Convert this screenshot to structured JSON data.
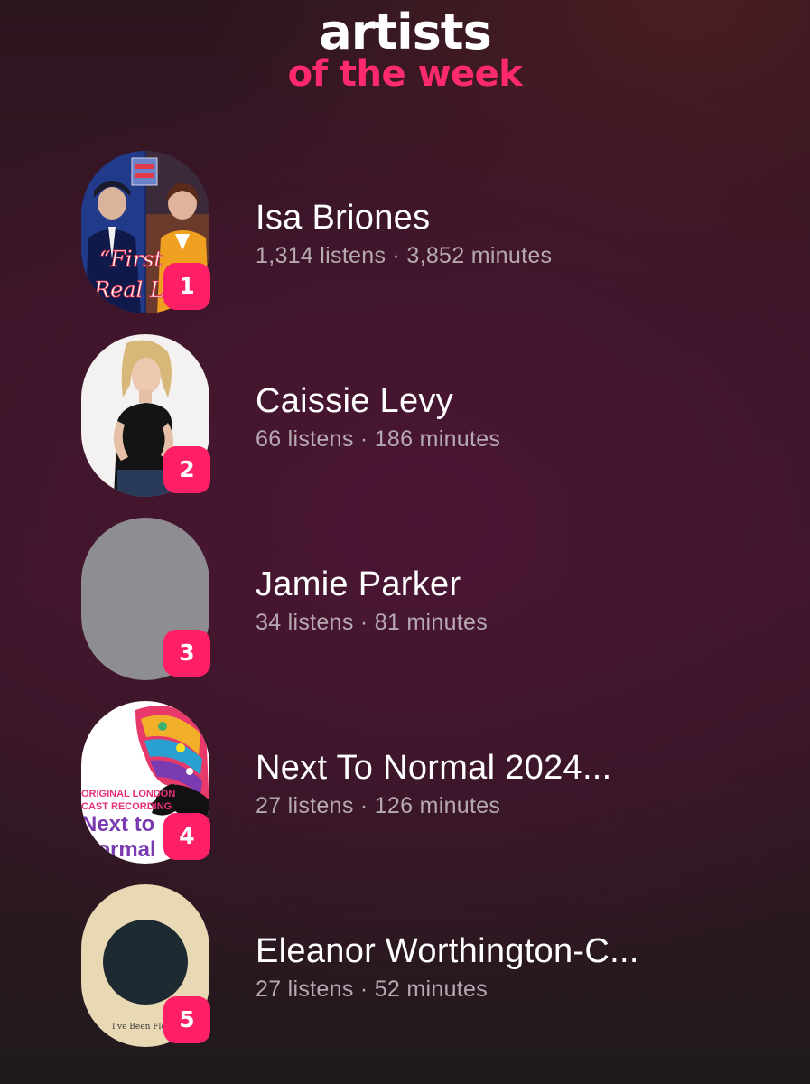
{
  "header": {
    "title": "artists",
    "subtitle": "of the week"
  },
  "artists": [
    {
      "rank": "1",
      "name": "Isa Briones",
      "stats": "1,314 listens · 3,852 minutes",
      "art": "album-cover-image"
    },
    {
      "rank": "2",
      "name": "Caissie Levy",
      "stats": "66 listens · 186 minutes",
      "art": "artist-photo"
    },
    {
      "rank": "3",
      "name": "Jamie Parker",
      "stats": "34 listens · 81 minutes",
      "art": "placeholder-gray"
    },
    {
      "rank": "4",
      "name": "Next To Normal 2024...",
      "stats": "27 listens · 126 minutes",
      "art": "album-cover-image",
      "cover_text": [
        "ORIGINAL LONDON",
        "CAST RECORDING",
        "Next to",
        "Normal"
      ]
    },
    {
      "rank": "5",
      "name": "Eleanor Worthington-C...",
      "stats": "27 listens · 52 minutes",
      "art": "album-cover-image",
      "cover_text": [
        "I've Been Floating"
      ]
    }
  ],
  "colors": {
    "accent": "#ff1f66",
    "subtitle": "#ff2a6d",
    "stats_text": "#b7a9b1",
    "placeholder": "#8e8d92"
  }
}
